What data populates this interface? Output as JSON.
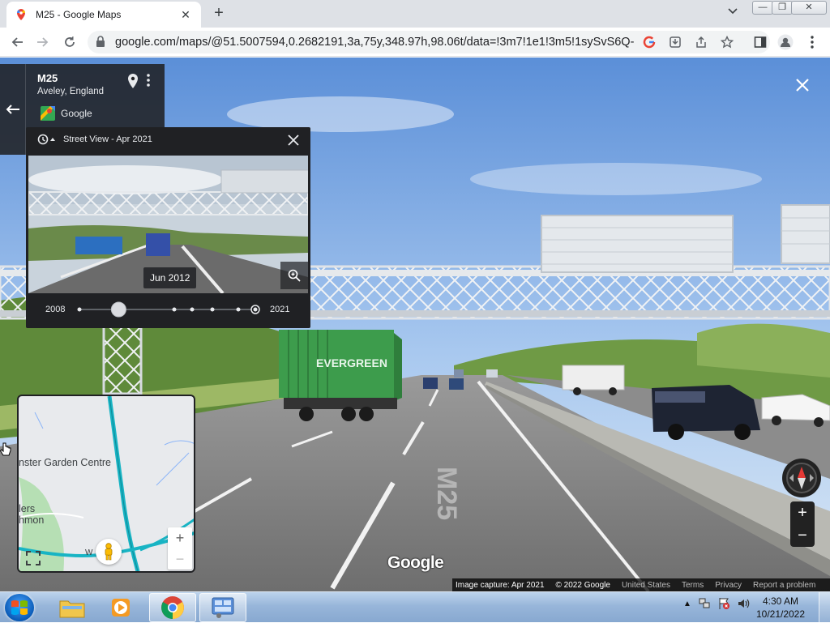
{
  "browser": {
    "tab_title": "M25 - Google Maps",
    "url": "google.com/maps/@51.5007594,0.2682191,3a,75y,348.97h,98.06t/data=!3m7!1e1!3m5!1sySvS6Q-YZ0..."
  },
  "location_card": {
    "name": "M25",
    "place": "Aveley, England",
    "provider": "Google"
  },
  "time_travel": {
    "header": "Street View - Apr 2021",
    "thumbnail_date": "Jun 2012",
    "start_year": "2008",
    "end_year": "2021",
    "selected_position": 0.22
  },
  "minimap": {
    "labels": [
      "nster Garden Centre",
      "lers",
      "hmon",
      "W"
    ]
  },
  "scene": {
    "truck_brand": "EVERGREEN",
    "road_marking": "M25"
  },
  "map_controls": {
    "zoom_in": "+",
    "zoom_out": "−"
  },
  "wordmark": "Google",
  "attribution": {
    "capture": "Image capture: Apr 2021",
    "copyright": "© 2022 Google",
    "country": "United States",
    "terms": "Terms",
    "privacy": "Privacy",
    "report": "Report a problem"
  },
  "taskbar": {
    "time": "4:30 AM",
    "date": "10/21/2022"
  },
  "colors": {
    "map_road": "#18b4c4",
    "map_background": "#e8eaed",
    "taskbar": "#98b6da",
    "panel": "#202124"
  }
}
